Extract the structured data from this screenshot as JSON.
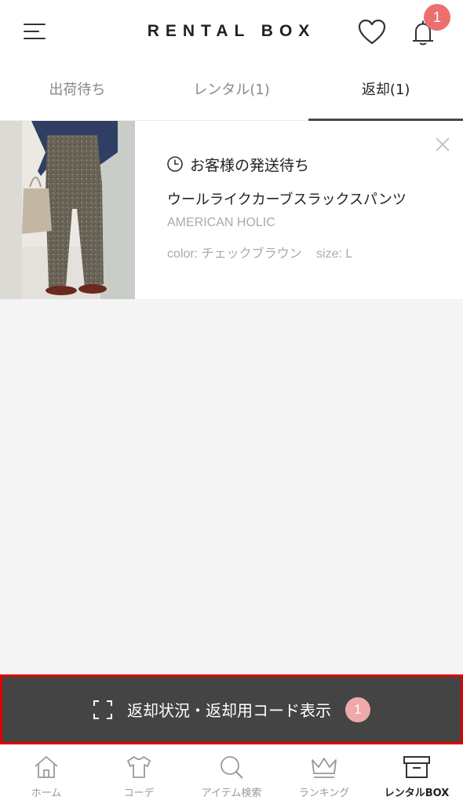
{
  "header": {
    "title": "RENTAL BOX",
    "notification_count": "1"
  },
  "tabs": [
    {
      "label": "出荷待ち",
      "active": false
    },
    {
      "label": "レンタル(1)",
      "active": false
    },
    {
      "label": "返却(1)",
      "active": true
    }
  ],
  "item": {
    "status": "お客様の発送待ち",
    "name": "ウールライクカーブスラックスパンツ",
    "brand": "AMERICAN HOLIC",
    "color": "color: チェックブラウン",
    "size": "size: L"
  },
  "return_bar": {
    "label": "返却状況・返却用コード表示",
    "badge": "1"
  },
  "bottom_nav": [
    {
      "label": "ホーム",
      "icon": "home-icon"
    },
    {
      "label": "コーデ",
      "icon": "tshirt-icon"
    },
    {
      "label": "アイテム検索",
      "icon": "search-icon"
    },
    {
      "label": "ランキング",
      "icon": "crown-icon"
    },
    {
      "label": "レンタルBOX",
      "icon": "box-icon",
      "active": true
    }
  ],
  "colors": {
    "accent_dark": "#4c4a3e",
    "badge": "#ec6f6f",
    "return_bar_bg": "#444444",
    "highlight_border": "#e00000"
  }
}
